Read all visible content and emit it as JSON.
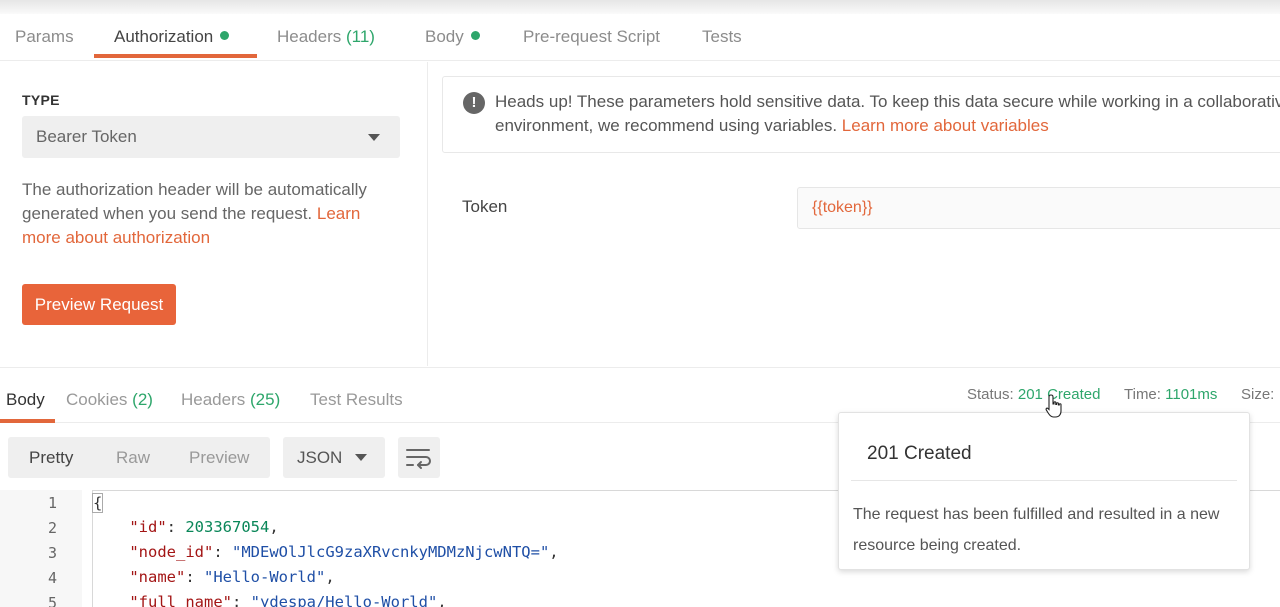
{
  "request_tabs": [
    {
      "label": "Params"
    },
    {
      "label": "Authorization"
    },
    {
      "label": "Headers",
      "count": "(11)"
    },
    {
      "label": "Body"
    },
    {
      "label": "Pre-request Script"
    },
    {
      "label": "Tests"
    }
  ],
  "auth": {
    "type_label": "TYPE",
    "type_value": "Bearer Token",
    "description": "The authorization header will be automatically generated when you send the request. ",
    "description_link": "Learn more about authorization",
    "preview_button": "Preview Request",
    "headsup_text": "Heads up! These parameters hold sensitive data. To keep this data secure while working in a collaborative environment, we recommend using variables. ",
    "headsup_link": "Learn more about variables",
    "token_label": "Token",
    "token_value": "{{token}}"
  },
  "response_tabs": [
    {
      "label": "Body"
    },
    {
      "label": "Cookies",
      "count": "(2)"
    },
    {
      "label": "Headers",
      "count": "(25)"
    },
    {
      "label": "Test Results"
    }
  ],
  "status": {
    "status_label": "Status:",
    "status_value": "201 Created",
    "time_label": "Time:",
    "time_value": "1101ms",
    "size_label": "Size:"
  },
  "format": {
    "options": [
      "Pretty",
      "Raw",
      "Preview"
    ],
    "selected": "Pretty",
    "language": "JSON"
  },
  "code": {
    "line_numbers": [
      "1",
      "2",
      "3",
      "4",
      "5"
    ],
    "lines": [
      {
        "open": "{"
      },
      {
        "key": "\"id\"",
        "value": "203367054",
        "type": "num"
      },
      {
        "key": "\"node_id\"",
        "value": "\"MDEwOlJlcG9zaXRvcnkyMDMzNjcwNTQ=\"",
        "type": "str"
      },
      {
        "key": "\"name\"",
        "value": "\"Hello-World\"",
        "type": "str"
      },
      {
        "key": "\"full_name\"",
        "value": "\"ydespa/Hello-World\"",
        "type": "str"
      }
    ]
  },
  "tooltip": {
    "title": "201 Created",
    "description": "The request has been fulfilled and resulted in a new resource being created."
  },
  "colors": {
    "accent": "#e2673b",
    "success": "#2ea66b"
  }
}
